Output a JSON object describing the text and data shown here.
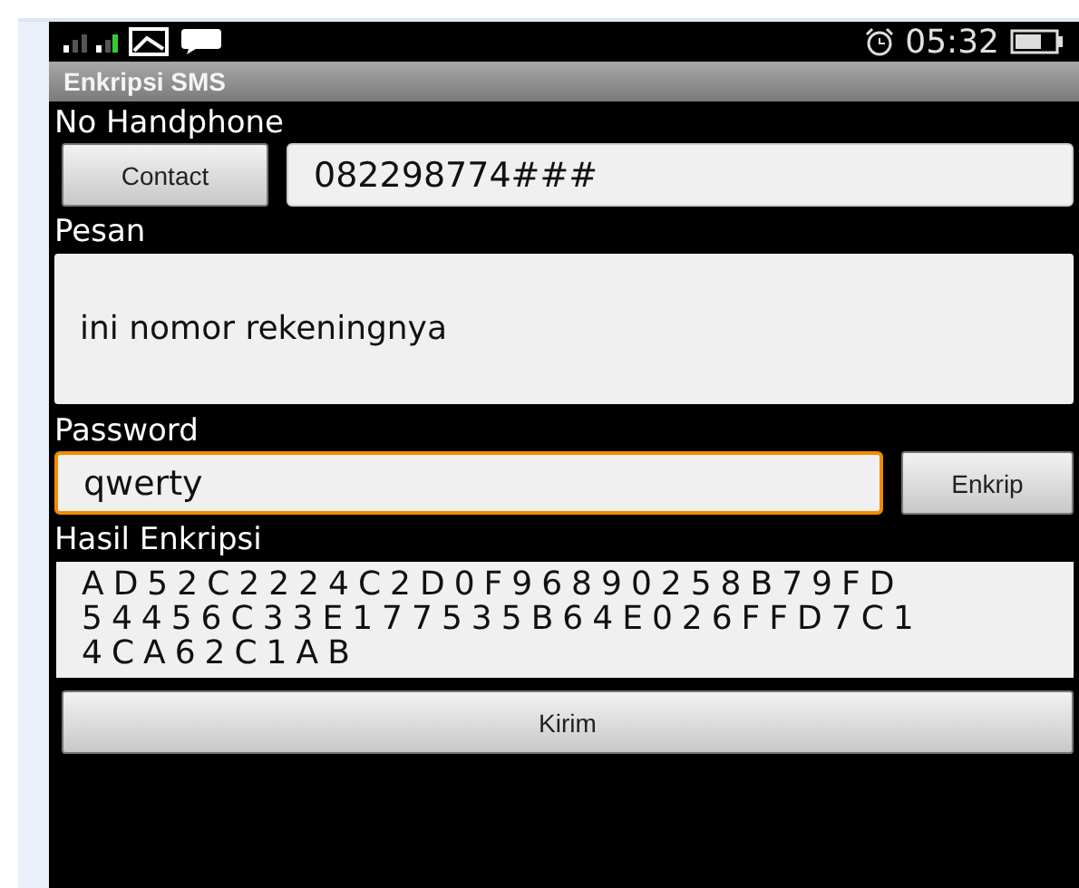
{
  "status_bar": {
    "time": "05:32"
  },
  "title": "Enkripsi SMS",
  "phone": {
    "label": "No Handphone",
    "contact_button": "Contact",
    "value": "082298774###"
  },
  "message": {
    "label": "Pesan",
    "value": "ini nomor rekeningnya"
  },
  "password": {
    "label": "Password",
    "value": "qwerty",
    "focused": true,
    "encrypt_button": "Enkrip"
  },
  "result": {
    "label": "Hasil Enkripsi",
    "lines": [
      "AD52C2224C2D0F96890258B79FD",
      "54456C33E177535B64E026FFD7C1",
      "4CA62C1AB"
    ]
  },
  "send_button": "Kirim"
}
